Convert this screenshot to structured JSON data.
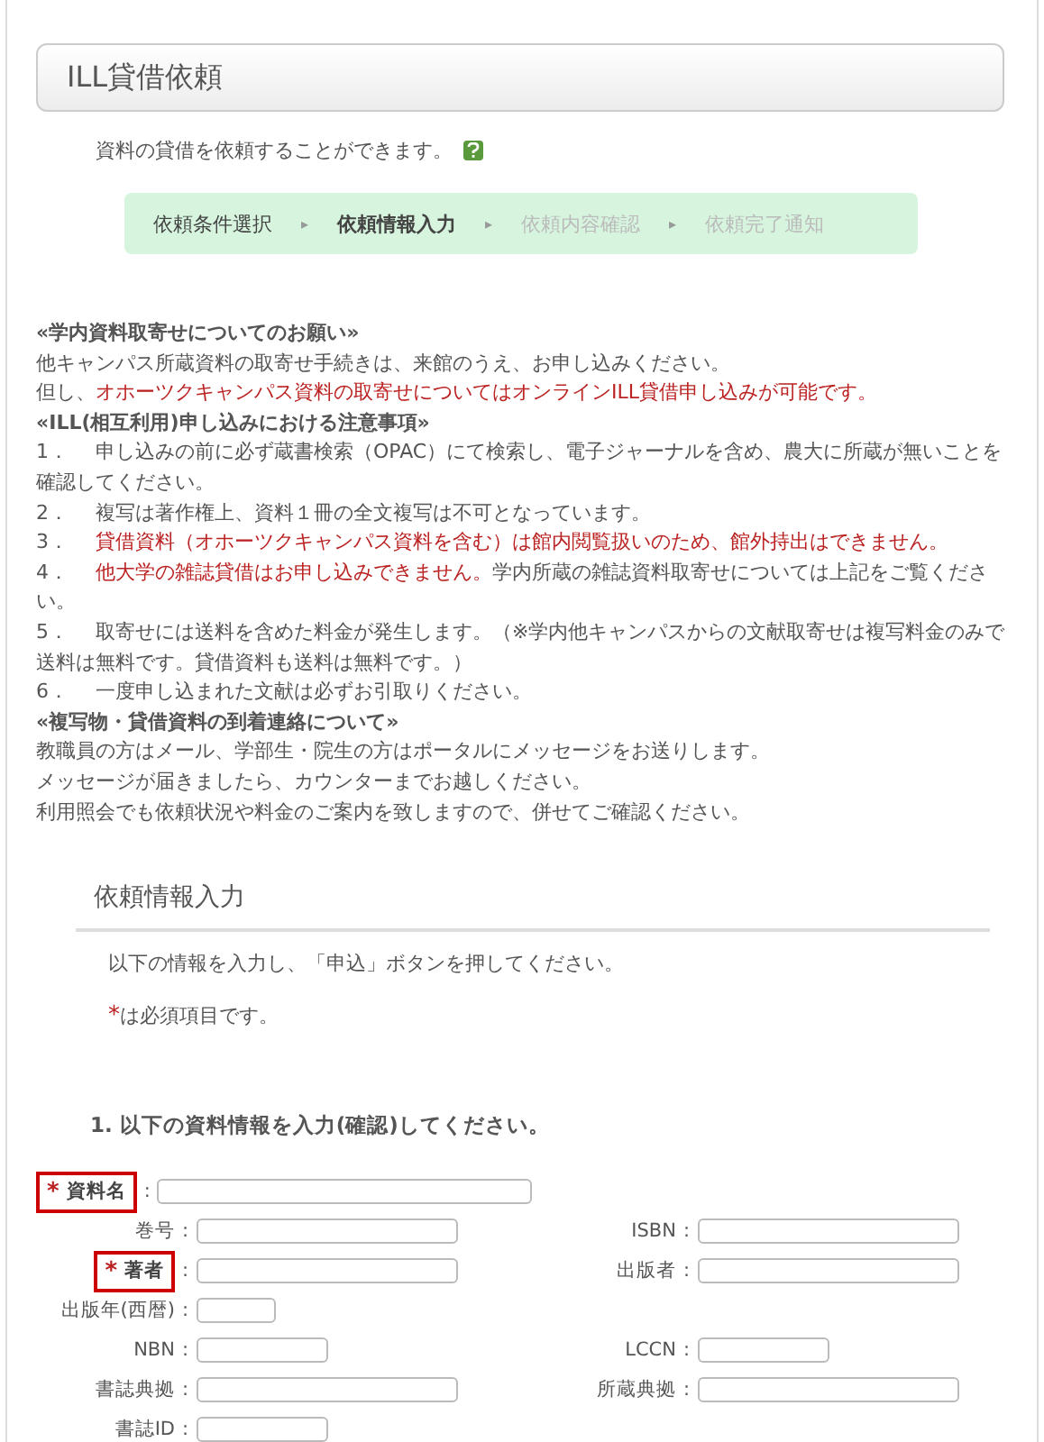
{
  "header": {
    "title": "ILL貸借依頼"
  },
  "intro": {
    "text": "資料の貸借を依頼することができます。"
  },
  "steps": [
    {
      "label": "依頼条件選択",
      "selected": false,
      "disabled": false
    },
    {
      "label": "依頼情報入力",
      "selected": true,
      "disabled": false
    },
    {
      "label": "依頼内容確認",
      "selected": false,
      "disabled": true
    },
    {
      "label": "依頼完了通知",
      "selected": false,
      "disabled": true
    }
  ],
  "step_separator": "▸",
  "notice": [
    {
      "kind": "heading",
      "parts": [
        {
          "text": "«学内資料取寄せについてのお願い»",
          "emphasis": false
        }
      ]
    },
    {
      "kind": "text",
      "parts": [
        {
          "text": "他キャンパス所蔵資料の取寄せ手続きは、来館のうえ、お申し込みください。",
          "emphasis": false
        }
      ]
    },
    {
      "kind": "text",
      "parts": [
        {
          "text": "但し、",
          "emphasis": false
        },
        {
          "text": "オホーツクキャンパス資料の取寄せについてはオンラインILL貸借申し込みが可能です。",
          "emphasis": true
        }
      ]
    },
    {
      "kind": "heading",
      "parts": [
        {
          "text": "«ILL(相互利用)申し込みにおける注意事項»",
          "emphasis": false
        }
      ]
    },
    {
      "kind": "numbered",
      "number": "1．",
      "parts": [
        {
          "text": "申し込みの前に必ず蔵書検索（OPAC）にて検索し、電子ジャーナルを含め、農大に所蔵が無いことを確認してください。",
          "emphasis": false
        }
      ]
    },
    {
      "kind": "numbered",
      "number": "2．",
      "parts": [
        {
          "text": "複写は著作権上、資料１冊の全文複写は不可となっています。",
          "emphasis": false
        }
      ]
    },
    {
      "kind": "numbered",
      "number": "3．",
      "parts": [
        {
          "text": "貸借資料（オホーツクキャンパス資料を含む）は館内閲覧扱いのため、館外持出はできません。",
          "emphasis": true
        }
      ]
    },
    {
      "kind": "numbered",
      "number": "4．",
      "parts": [
        {
          "text": "他大学の雑誌貸借はお申し込みできません。",
          "emphasis": true
        },
        {
          "text": "学内所蔵の雑誌資料取寄せについては上記をご覧ください。",
          "emphasis": false
        }
      ]
    },
    {
      "kind": "numbered",
      "number": "5．",
      "parts": [
        {
          "text": "取寄せには送料を含めた料金が発生します。（※学内他キャンパスからの文献取寄せは複写料金のみで送料は無料です。貸借資料も送料は無料です。）",
          "emphasis": false
        }
      ]
    },
    {
      "kind": "numbered",
      "number": "6．",
      "parts": [
        {
          "text": "一度申し込まれた文献は必ずお引取りください。",
          "emphasis": false
        }
      ]
    },
    {
      "kind": "heading",
      "parts": [
        {
          "text": "«複写物・貸借資料の到着連絡について»",
          "emphasis": false
        }
      ]
    },
    {
      "kind": "text",
      "parts": [
        {
          "text": "教職員の方はメール、学部生・院生の方はポータルにメッセージをお送りします。",
          "emphasis": false
        }
      ]
    },
    {
      "kind": "text",
      "parts": [
        {
          "text": "メッセージが届きましたら、カウンターまでお越しください。",
          "emphasis": false
        }
      ]
    },
    {
      "kind": "text",
      "parts": [
        {
          "text": "利用照会でも依頼状況や料金のご案内を致しますので、併せてご確認ください。",
          "emphasis": false
        }
      ]
    }
  ],
  "section": {
    "title": "依頼情報入力",
    "instruction": "以下の情報を入力し、「申込」ボタンを押してください。",
    "required_mark": "*",
    "required_note": "は必須項目です。"
  },
  "form": {
    "title": "1. 以下の資料情報を入力(確認)してください。",
    "rows": [
      {
        "fields": [
          {
            "label": "資料名",
            "required": true,
            "kind": "wide"
          }
        ]
      },
      {
        "fields": [
          {
            "label": "巻号",
            "required": false,
            "kind": "medium"
          },
          {
            "label": "ISBN",
            "required": false,
            "kind": "medium"
          }
        ]
      },
      {
        "fields": [
          {
            "label": "著者",
            "required": true,
            "kind": "medium"
          },
          {
            "label": "出版者",
            "required": false,
            "kind": "long"
          }
        ]
      },
      {
        "fields": [
          {
            "label": "出版年(西暦)",
            "required": false,
            "kind": "year"
          }
        ]
      },
      {
        "fields": [
          {
            "label": "NBN",
            "required": false,
            "kind": "short"
          },
          {
            "label": "LCCN",
            "required": false,
            "kind": "short"
          }
        ]
      },
      {
        "fields": [
          {
            "label": "書誌典拠",
            "required": false,
            "kind": "medium"
          },
          {
            "label": "所蔵典拠",
            "required": false,
            "kind": "long"
          }
        ]
      },
      {
        "fields": [
          {
            "label": "書誌ID",
            "required": false,
            "kind": "short"
          }
        ]
      }
    ],
    "colon": ":"
  }
}
